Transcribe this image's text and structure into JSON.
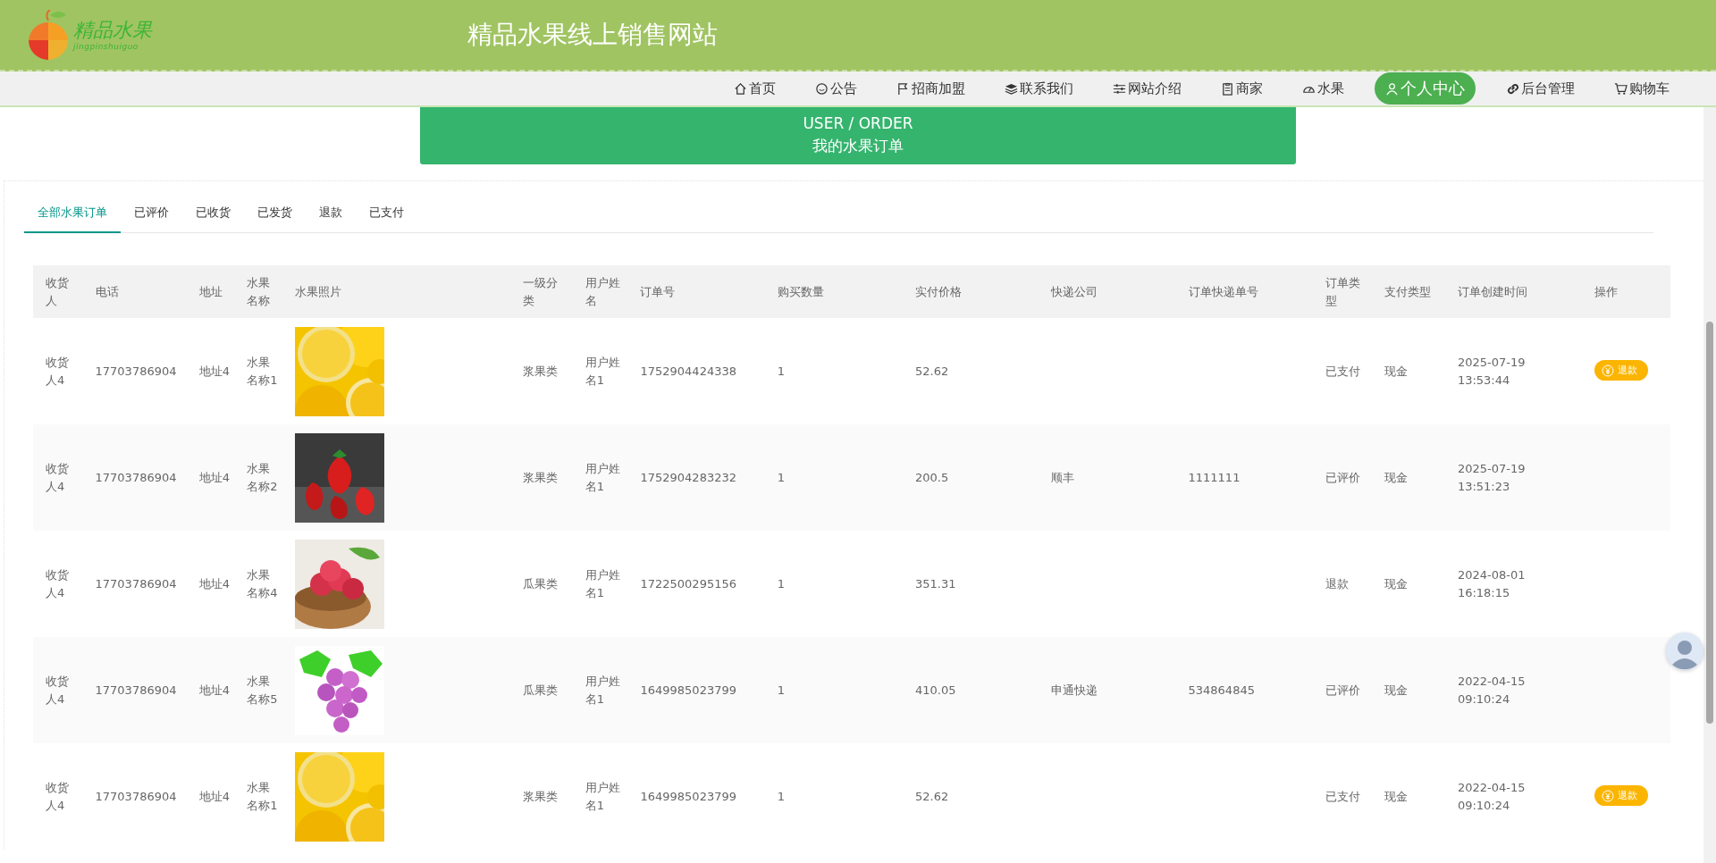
{
  "header": {
    "logo_text": "精品水果",
    "logo_subtext": "jingpinshuiguo",
    "site_title": "精品水果线上销售网站"
  },
  "nav": [
    {
      "label": "首页",
      "selected": false
    },
    {
      "label": "公告",
      "selected": false
    },
    {
      "label": "招商加盟",
      "selected": false
    },
    {
      "label": "联系我们",
      "selected": false
    },
    {
      "label": "网站介绍",
      "selected": false
    },
    {
      "label": "商家",
      "selected": false
    },
    {
      "label": "水果",
      "selected": false
    },
    {
      "label": "个人中心",
      "selected": true
    },
    {
      "label": "后台管理",
      "selected": false
    },
    {
      "label": "购物车",
      "selected": false
    }
  ],
  "banner": {
    "title": "USER / ORDER",
    "subtitle": "我的水果订单"
  },
  "tabs": [
    {
      "label": "全部水果订单",
      "selected": true
    },
    {
      "label": "已评价",
      "selected": false
    },
    {
      "label": "已收货",
      "selected": false
    },
    {
      "label": "已发货",
      "selected": false
    },
    {
      "label": "退款",
      "selected": false
    },
    {
      "label": "已支付",
      "selected": false
    }
  ],
  "table": {
    "columns": [
      "收货人",
      "电话",
      "地址",
      "水果名称",
      "水果照片",
      "一级分类",
      "用户姓名",
      "订单号",
      "购买数量",
      "实付价格",
      "快递公司",
      "订单快递单号",
      "订单类型",
      "支付类型",
      "订单创建时间",
      "操作"
    ],
    "rows": [
      {
        "receiver": "收货人4",
        "phone": "17703786904",
        "address": "地址4",
        "fruit_name": "水果名称1",
        "category": "浆果类",
        "user_name": "用户姓名1",
        "order_no": "1752904424338",
        "quantity": "1",
        "price": "52.62",
        "order_type": "已支付",
        "pay_type": "现金",
        "created": "2025-07-19 13:53:44",
        "action": "退款"
      },
      {
        "receiver": "收货人4",
        "phone": "17703786904",
        "address": "地址4",
        "fruit_name": "水果名称2",
        "category": "浆果类",
        "user_name": "用户姓名1",
        "order_no": "1752904283232",
        "quantity": "1",
        "price": "200.5",
        "courier": "顺丰",
        "tracking_no": "1111111",
        "order_type": "已评价",
        "pay_type": "现金",
        "created": "2025-07-19 13:51:23"
      },
      {
        "receiver": "收货人4",
        "phone": "17703786904",
        "address": "地址4",
        "fruit_name": "水果名称4",
        "category": "瓜果类",
        "user_name": "用户姓名1",
        "order_no": "1722500295156",
        "quantity": "1",
        "price": "351.31",
        "order_type": "退款",
        "pay_type": "现金",
        "created": "2024-08-01 16:18:15"
      },
      {
        "receiver": "收货人4",
        "phone": "17703786904",
        "address": "地址4",
        "fruit_name": "水果名称5",
        "category": "瓜果类",
        "user_name": "用户姓名1",
        "order_no": "1649985023799",
        "quantity": "1",
        "price": "410.05",
        "courier": "申通快递",
        "tracking_no": "534864845",
        "order_type": "已评价",
        "pay_type": "现金",
        "created": "2022-04-15 09:10:24"
      },
      {
        "receiver": "收货人4",
        "phone": "17703786904",
        "address": "地址4",
        "fruit_name": "水果名称1",
        "category": "浆果类",
        "user_name": "用户姓名1",
        "order_no": "1649985023799",
        "quantity": "1",
        "price": "52.62",
        "order_type": "已支付",
        "pay_type": "现金",
        "created": "2022-04-15 09:10:24",
        "action": "退款"
      }
    ]
  }
}
